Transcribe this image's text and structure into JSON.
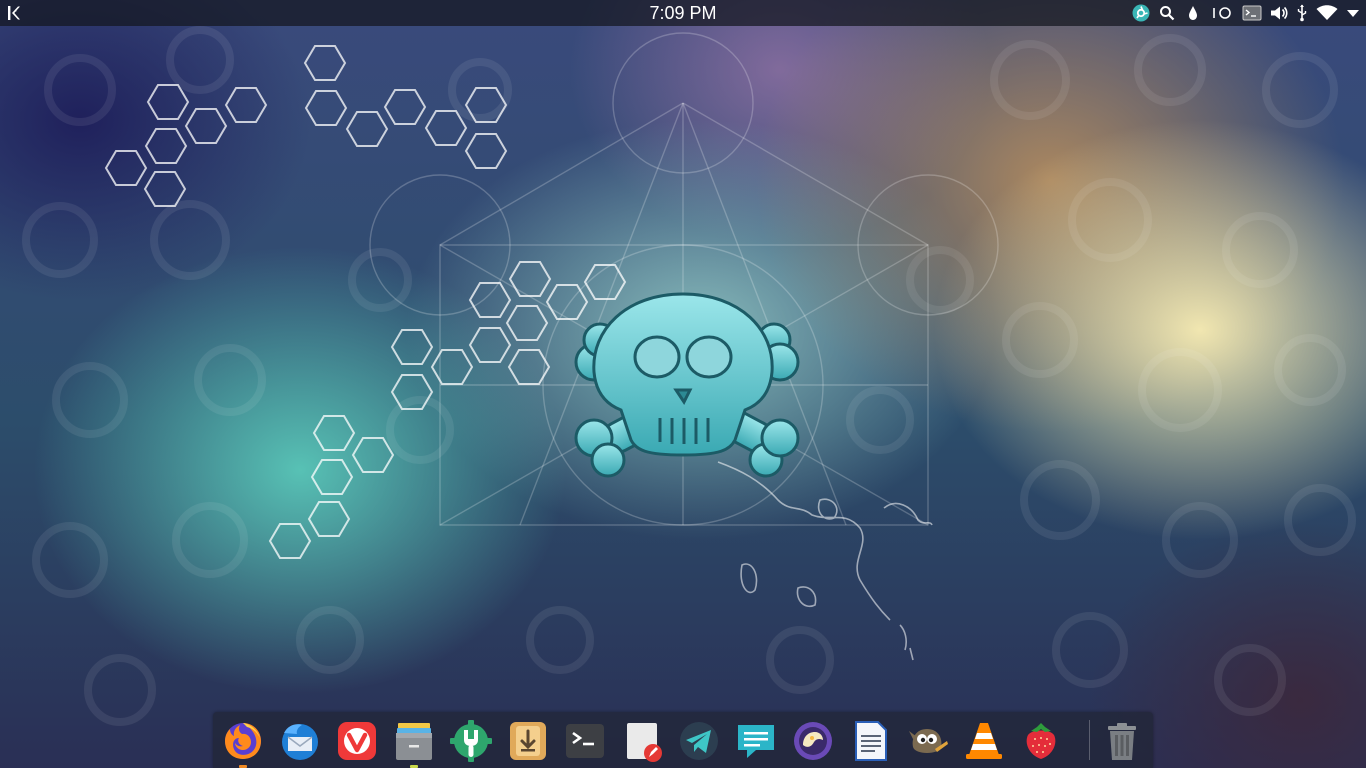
{
  "top_panel": {
    "clock_time": "7:09 PM",
    "launcher_icon": "kde-icon",
    "tray_icons": [
      "steam-icon",
      "search-icon",
      "vpn-drop-icon",
      "power-icon",
      "terminal-icon",
      "volume-icon",
      "usb-icon",
      "wifi-icon",
      "menu-arrow-icon"
    ]
  },
  "dock": {
    "apps": [
      {
        "name": "firefox-icon",
        "running": true,
        "indicator_color": "#f08a24"
      },
      {
        "name": "thunderbird-icon",
        "running": false
      },
      {
        "name": "vivaldi-icon",
        "running": false
      },
      {
        "name": "file-manager-icon",
        "running": true,
        "indicator_color": "#c9d84a"
      },
      {
        "name": "settings-wrench-icon",
        "running": false
      },
      {
        "name": "package-installer-icon",
        "running": false
      },
      {
        "name": "terminal-icon",
        "running": false
      },
      {
        "name": "text-editor-icon",
        "running": false
      },
      {
        "name": "telegram-icon",
        "running": false
      },
      {
        "name": "chat-messenger-icon",
        "running": false
      },
      {
        "name": "cantata-music-icon",
        "running": false
      },
      {
        "name": "document-viewer-icon",
        "running": false
      },
      {
        "name": "gimp-icon",
        "running": false
      },
      {
        "name": "vlc-icon",
        "running": false
      },
      {
        "name": "strawberry-icon",
        "running": false
      },
      {
        "name": "trash-icon",
        "running": false
      }
    ]
  },
  "colors": {
    "panel_bg": "#14161e",
    "accent_teal": "#3ab6b6",
    "logo_skull": "#5cc9cf"
  }
}
